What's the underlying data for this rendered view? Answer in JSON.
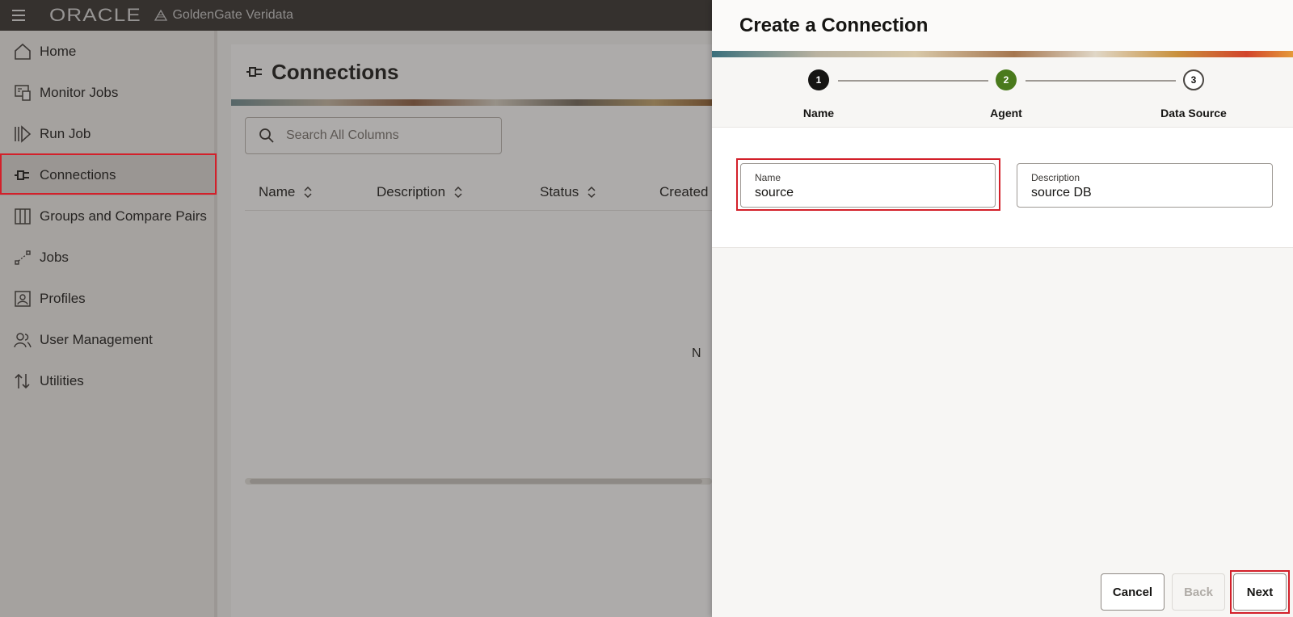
{
  "topbar": {
    "brand": "ORACLE",
    "product": "GoldenGate Veridata"
  },
  "sidebar": {
    "items": [
      {
        "label": "Home",
        "icon": "home-icon"
      },
      {
        "label": "Monitor Jobs",
        "icon": "monitor-icon"
      },
      {
        "label": "Run Job",
        "icon": "run-icon"
      },
      {
        "label": "Connections",
        "icon": "plug-icon",
        "active": true
      },
      {
        "label": "Groups and Compare Pairs",
        "icon": "columns-icon"
      },
      {
        "label": "Jobs",
        "icon": "jobs-icon"
      },
      {
        "label": "Profiles",
        "icon": "profile-icon"
      },
      {
        "label": "User Management",
        "icon": "users-icon"
      },
      {
        "label": "Utilities",
        "icon": "sort-arrows-icon"
      }
    ]
  },
  "main": {
    "title": "Connections",
    "search_placeholder": "Search All Columns",
    "columns": [
      "Name",
      "Description",
      "Status",
      "Created"
    ],
    "empty_text": "N"
  },
  "drawer": {
    "title": "Create a Connection",
    "steps": [
      {
        "number": "1",
        "label": "Name",
        "state": "done"
      },
      {
        "number": "2",
        "label": "Agent",
        "state": "current"
      },
      {
        "number": "3",
        "label": "Data Source",
        "state": "todo"
      }
    ],
    "fields": {
      "name": {
        "label": "Name",
        "value": "source"
      },
      "description": {
        "label": "Description",
        "value": "source DB"
      }
    },
    "buttons": {
      "cancel": "Cancel",
      "back": "Back",
      "next": "Next"
    }
  },
  "colors": {
    "highlight": "#d3202a",
    "step_current": "#4a7a1c",
    "topbar": "#312d2a"
  }
}
